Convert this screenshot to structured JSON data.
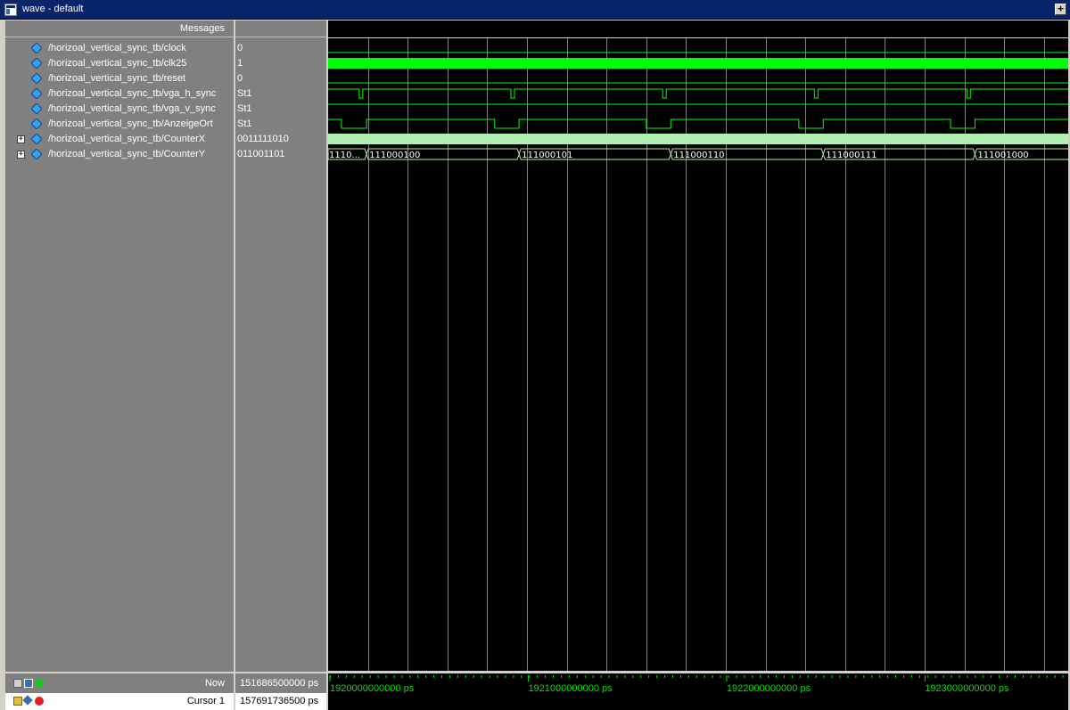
{
  "window": {
    "title": "wave - default",
    "max_symbol": "+"
  },
  "headers": {
    "messages": "Messages"
  },
  "signals": [
    {
      "name": "/horizoal_vertical_sync_tb/clock",
      "value": "0",
      "expandable": false,
      "expander_symbol": ""
    },
    {
      "name": "/horizoal_vertical_sync_tb/clk25",
      "value": "1",
      "expandable": false,
      "expander_symbol": ""
    },
    {
      "name": "/horizoal_vertical_sync_tb/reset",
      "value": "0",
      "expandable": false,
      "expander_symbol": ""
    },
    {
      "name": "/horizoal_vertical_sync_tb/vga_h_sync",
      "value": "St1",
      "expandable": false,
      "expander_symbol": ""
    },
    {
      "name": "/horizoal_vertical_sync_tb/vga_v_sync",
      "value": "St1",
      "expandable": false,
      "expander_symbol": ""
    },
    {
      "name": "/horizoal_vertical_sync_tb/AnzeigeOrt",
      "value": "St1",
      "expandable": false,
      "expander_symbol": ""
    },
    {
      "name": "/horizoal_vertical_sync_tb/CounterX",
      "value": "0011111010",
      "expandable": true,
      "expander_symbol": "+"
    },
    {
      "name": "/horizoal_vertical_sync_tb/CounterY",
      "value": "011001101",
      "expandable": true,
      "expander_symbol": "+"
    }
  ],
  "counter_y_segments": [
    {
      "label": "1110...",
      "start_frac": 0.0
    },
    {
      "label": "111000100",
      "start_frac": 0.052
    },
    {
      "label": "111000101",
      "start_frac": 0.258
    },
    {
      "label": "111000110",
      "start_frac": 0.463
    },
    {
      "label": "111000111",
      "start_frac": 0.669
    },
    {
      "label": "111001000",
      "start_frac": 0.874
    }
  ],
  "h_sync_pulses_frac": [
    0.042,
    0.247,
    0.452,
    0.657,
    0.863
  ],
  "anzeige_low_frac": [
    [
      0.018,
      0.052
    ],
    [
      0.225,
      0.258
    ],
    [
      0.43,
      0.463
    ],
    [
      0.636,
      0.669
    ],
    [
      0.841,
      0.874
    ]
  ],
  "status": {
    "now_label": "Now",
    "now_value": "151686500000 ps",
    "cursor_label": "Cursor 1",
    "cursor_value": "157691736500 ps"
  },
  "timeline": {
    "ticks": [
      {
        "label": "1920000000000 ps",
        "frac": 0.0
      },
      {
        "label": "1921000000000 ps",
        "frac": 0.268
      },
      {
        "label": "1922000000000 ps",
        "frac": 0.536
      },
      {
        "label": "1923000000000 ps",
        "frac": 0.804
      }
    ]
  },
  "colors": {
    "wave_green": "#00ff00",
    "wave_light_green": "#b0f0b0",
    "grid": "#808080",
    "timeline_text": "#00e000"
  },
  "icons": {
    "signal": "diamond-signal-icon",
    "expander": "plus-expander-icon"
  }
}
